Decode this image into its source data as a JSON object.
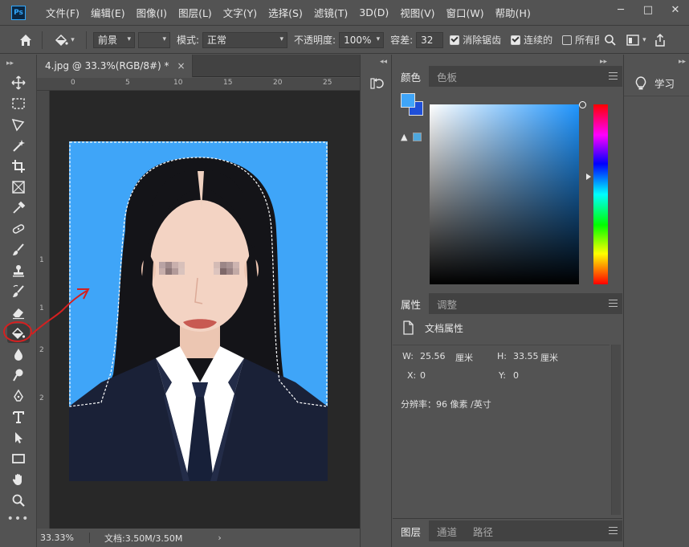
{
  "app": {
    "logo": "Ps"
  },
  "menu": [
    "文件(F)",
    "编辑(E)",
    "图像(I)",
    "图层(L)",
    "文字(Y)",
    "选择(S)",
    "滤镜(T)",
    "3D(D)",
    "视图(V)",
    "窗口(W)",
    "帮助(H)"
  ],
  "window_controls": {
    "minimize": "─",
    "maximize": "□",
    "close": "✕"
  },
  "options": {
    "fill_source": "前景",
    "mode_label": "模式:",
    "mode_value": "正常",
    "opacity_label": "不透明度:",
    "opacity_value": "100%",
    "tolerance_label": "容差:",
    "tolerance_value": "32",
    "antialias_label": "消除锯齿",
    "antialias_checked": true,
    "contiguous_label": "连续的",
    "contiguous_checked": true,
    "all_layers_label": "所有图层",
    "all_layers_checked": false
  },
  "tools": [
    {
      "name": "move-tool"
    },
    {
      "name": "marquee-tool"
    },
    {
      "name": "lasso-tool"
    },
    {
      "name": "magic-wand-tool"
    },
    {
      "name": "crop-tool"
    },
    {
      "name": "frame-tool"
    },
    {
      "name": "eyedropper-tool"
    },
    {
      "name": "healing-brush-tool"
    },
    {
      "name": "brush-tool"
    },
    {
      "name": "clone-stamp-tool"
    },
    {
      "name": "history-brush-tool"
    },
    {
      "name": "eraser-tool"
    },
    {
      "name": "paint-bucket-tool",
      "active": true
    },
    {
      "name": "blur-tool"
    },
    {
      "name": "dodge-tool"
    },
    {
      "name": "pen-tool"
    },
    {
      "name": "type-tool"
    },
    {
      "name": "path-selection-tool"
    },
    {
      "name": "rectangle-tool"
    },
    {
      "name": "hand-tool"
    },
    {
      "name": "zoom-tool"
    }
  ],
  "document": {
    "tab_title": "4.jpg @ 33.3%(RGB/8#) *",
    "tab_close": "×",
    "ruler_top": [
      "0",
      "5",
      "10",
      "15",
      "20",
      "25"
    ],
    "ruler_left": [
      "1",
      "1",
      "2",
      "2"
    ],
    "zoom": "33.33%",
    "doc_size": "文档:3.50M/3.50M",
    "status_arrow": "›",
    "canvas_bg": "#3fa5f8"
  },
  "color_panel": {
    "tabs": [
      "颜色",
      "色板"
    ],
    "foreground": "#3fa5f8",
    "background": "#1f4fd8",
    "warning": "▲"
  },
  "properties_panel": {
    "tabs": [
      "属性",
      "调整"
    ],
    "title": "文档属性",
    "w_label": "W:",
    "w_value": "25.56",
    "w_unit": "厘米",
    "h_label": "H:",
    "h_value": "33.55",
    "h_unit": "厘米",
    "x_label": "X:",
    "x_value": "0",
    "y_label": "Y:",
    "y_value": "0",
    "resolution": "分辨率：96 像素 /英寸"
  },
  "layers_panel": {
    "tabs": [
      "图层",
      "通道",
      "路径"
    ]
  },
  "learn_panel": {
    "label": "学习"
  },
  "collapse": "◂◂",
  "expand": "▸▸"
}
